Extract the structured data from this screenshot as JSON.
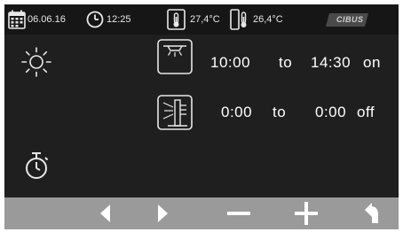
{
  "status_bar": {
    "date": "06.06.16",
    "time": "12:25",
    "temp_inside": "27,4°C",
    "temp_outside": "26,4°C",
    "brand": "CIBUS"
  },
  "programs": [
    {
      "icon": "ceiling-lamp-icon",
      "start": "10:00",
      "sep": "to",
      "end": "14:30",
      "state": "on"
    },
    {
      "icon": "lamp-shade-icon",
      "start": "0:00",
      "sep": "to",
      "end": "0:00",
      "state": "off"
    }
  ],
  "side_icons": [
    "sun-icon",
    "timer-icon"
  ],
  "toolbar": [
    "arrow-left-icon",
    "arrow-right-icon",
    "minus-icon",
    "plus-icon",
    "back-icon"
  ],
  "colors": {
    "background": "#1f1f1f",
    "toolbar": "#9a9a9a",
    "text": "#ffffff"
  }
}
